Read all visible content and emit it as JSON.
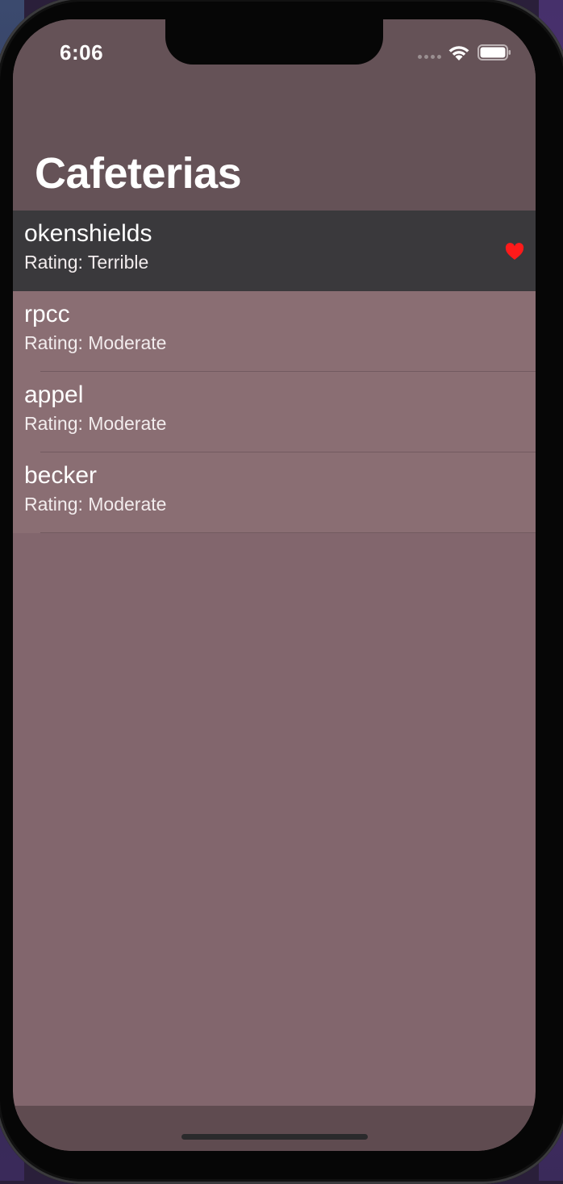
{
  "status_bar": {
    "time": "6:06"
  },
  "nav": {
    "title": "Cafeterias"
  },
  "cafeterias": [
    {
      "name": "okenshields",
      "rating": "Rating: Terrible",
      "favorite": true,
      "selected": true
    },
    {
      "name": "rpcc",
      "rating": "Rating: Moderate",
      "favorite": false,
      "selected": false
    },
    {
      "name": "appel",
      "rating": "Rating: Moderate",
      "favorite": false,
      "selected": false
    },
    {
      "name": "becker",
      "rating": "Rating: Moderate",
      "favorite": false,
      "selected": false
    }
  ],
  "colors": {
    "background": "#82666d",
    "nav_background": "#655257",
    "row_background": "#8a6e73",
    "selected_row": "#3a393c",
    "favorite_heart": "#ff1a1a"
  }
}
